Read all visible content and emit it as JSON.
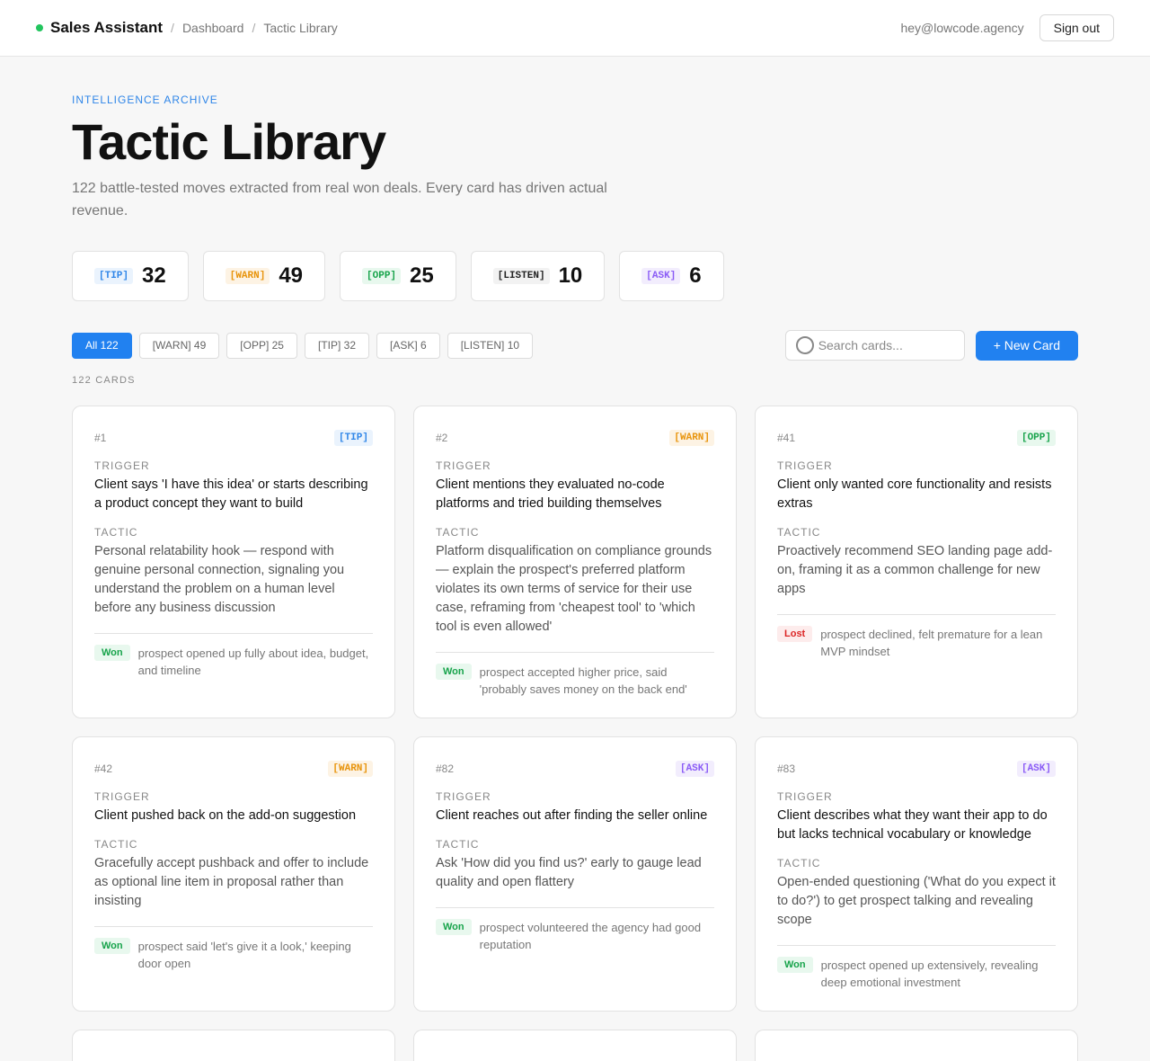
{
  "header": {
    "brand": "Sales Assistant",
    "breadcrumb": [
      "Dashboard",
      "Tactic Library"
    ],
    "separator": "/",
    "email": "hey@lowcode.agency",
    "sign_out": "Sign out"
  },
  "hero": {
    "eyebrow": "INTELLIGENCE ARCHIVE",
    "title": "Tactic Library",
    "subtitle": "122 battle-tested moves extracted from real won deals. Every card has driven actual revenue."
  },
  "stats": [
    {
      "tag": "[TIP]",
      "value": "32"
    },
    {
      "tag": "[WARN]",
      "value": "49"
    },
    {
      "tag": "[OPP]",
      "value": "25"
    },
    {
      "tag": "[LISTEN]",
      "value": "10"
    },
    {
      "tag": "[ASK]",
      "value": "6"
    }
  ],
  "filters": [
    "All 122",
    "[WARN] 49",
    "[OPP] 25",
    "[TIP] 32",
    "[ASK] 6",
    "[LISTEN] 10"
  ],
  "active_filter": "All 122",
  "search": {
    "placeholder": "Search cards...",
    "icon": "search-icon"
  },
  "new_card": "+ New Card",
  "card_count": "122 CARDS",
  "labels": {
    "trigger": "TRIGGER",
    "tactic": "TACTIC"
  },
  "colors": {
    "accent": "#2181f0",
    "tip": "#2f86e8",
    "warn": "#e8940c",
    "opp": "#16a34a",
    "ask": "#8b5cf6",
    "listen": "#222222",
    "won": "#16a34a",
    "lost": "#dc2626"
  },
  "cards": [
    {
      "num": "#1",
      "tag": "[TIP]",
      "trigger": "Client says 'I have this idea' or starts describing a product concept they want to build",
      "tactic": "Personal relatability hook — respond with genuine personal connection, signaling you understand the problem on a human level before any business discussion",
      "outcome": "Won",
      "note": "prospect opened up fully about idea, budget, and timeline"
    },
    {
      "num": "#2",
      "tag": "[WARN]",
      "trigger": "Client mentions they evaluated no-code platforms and tried building themselves",
      "tactic": "Platform disqualification on compliance grounds — explain the prospect's preferred platform violates its own terms of service for their use case, reframing from 'cheapest tool' to 'which tool is even allowed'",
      "outcome": "Won",
      "note": "prospect accepted higher price, said 'probably saves money on the back end'"
    },
    {
      "num": "#41",
      "tag": "[OPP]",
      "trigger": "Client only wanted core functionality and resists extras",
      "tactic": "Proactively recommend SEO landing page add-on, framing it as a common challenge for new apps",
      "outcome": "Lost",
      "note": "prospect declined, felt premature for a lean MVP mindset"
    },
    {
      "num": "#42",
      "tag": "[WARN]",
      "trigger": "Client pushed back on the add-on suggestion",
      "tactic": "Gracefully accept pushback and offer to include as optional line item in proposal rather than insisting",
      "outcome": "Won",
      "note": "prospect said 'let's give it a look,' keeping door open"
    },
    {
      "num": "#82",
      "tag": "[ASK]",
      "trigger": "Client reaches out after finding the seller online",
      "tactic": "Ask 'How did you find us?' early to gauge lead quality and open flattery",
      "outcome": "Won",
      "note": "prospect volunteered the agency had good reputation"
    },
    {
      "num": "#83",
      "tag": "[ASK]",
      "trigger": "Client describes what they want their app to do but lacks technical vocabulary or knowledge",
      "tactic": "Open-ended questioning ('What do you expect it to do?') to get prospect talking and revealing scope",
      "outcome": "Won",
      "note": "prospect opened up extensively, revealing deep emotional investment"
    }
  ]
}
